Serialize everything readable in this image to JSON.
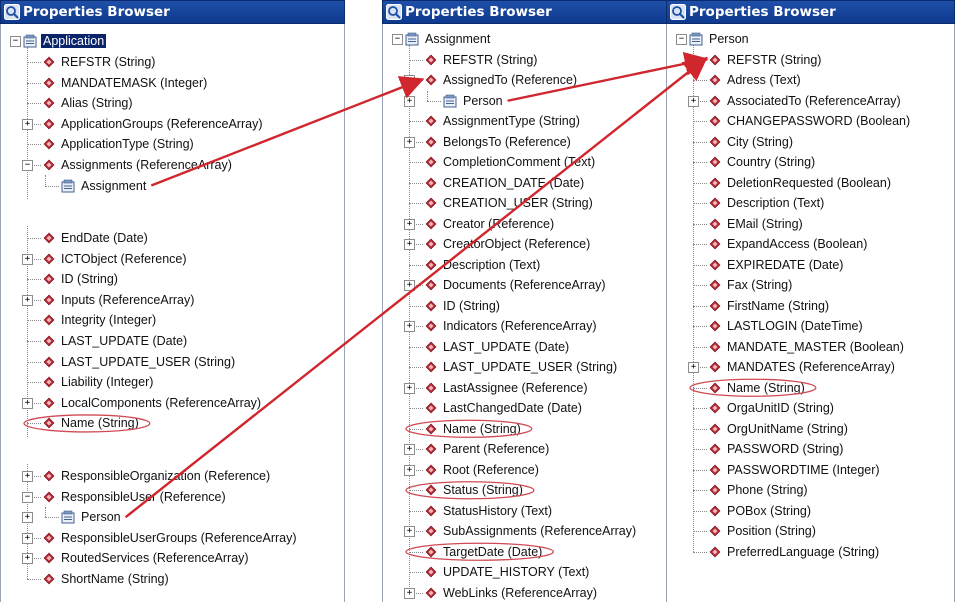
{
  "panels": [
    {
      "title": "Properties Browser",
      "rows": [
        {
          "text": "Application",
          "kind": "root",
          "exp": "-",
          "selected": true
        },
        {
          "text": "REFSTR (String)",
          "kind": "prop"
        },
        {
          "text": "MANDATEMASK (Integer)",
          "kind": "prop"
        },
        {
          "text": "Alias (String)",
          "kind": "prop"
        },
        {
          "text": "ApplicationGroups (ReferenceArray)",
          "kind": "prop",
          "exp": "+"
        },
        {
          "text": "ApplicationType (String)",
          "kind": "prop"
        },
        {
          "text": "Assignments (ReferenceArray)",
          "kind": "prop",
          "exp": "-"
        },
        {
          "text": "Assignment",
          "kind": "obj",
          "level": 2
        },
        {
          "gap": true
        },
        {
          "text": "EndDate (Date)",
          "kind": "prop"
        },
        {
          "text": "ICTObject (Reference)",
          "kind": "prop",
          "exp": "+"
        },
        {
          "text": "ID (String)",
          "kind": "prop"
        },
        {
          "text": "Inputs (ReferenceArray)",
          "kind": "prop",
          "exp": "+"
        },
        {
          "text": "Integrity (Integer)",
          "kind": "prop"
        },
        {
          "text": "LAST_UPDATE (Date)",
          "kind": "prop"
        },
        {
          "text": "LAST_UPDATE_USER (String)",
          "kind": "prop"
        },
        {
          "text": "Liability (Integer)",
          "kind": "prop"
        },
        {
          "text": "LocalComponents (ReferenceArray)",
          "kind": "prop",
          "exp": "+"
        },
        {
          "text": "Name (String)",
          "kind": "prop",
          "circled": true
        },
        {
          "gap": true
        },
        {
          "text": "ResponsibleOrganization (Reference)",
          "kind": "prop",
          "exp": "+"
        },
        {
          "text": "ResponsibleUser (Reference)",
          "kind": "prop",
          "exp": "-"
        },
        {
          "text": "Person",
          "kind": "obj",
          "level": 2,
          "exp": "+"
        },
        {
          "text": "ResponsibleUserGroups (ReferenceArray)",
          "kind": "prop",
          "exp": "+"
        },
        {
          "text": "RoutedServices (ReferenceArray)",
          "kind": "prop",
          "exp": "+"
        },
        {
          "text": "ShortName (String)",
          "kind": "prop"
        }
      ]
    },
    {
      "title": "Properties Browser",
      "rows": [
        {
          "text": "Assignment",
          "kind": "root",
          "exp": "-"
        },
        {
          "text": "REFSTR (String)",
          "kind": "prop"
        },
        {
          "text": "AssignedTo (Reference)",
          "kind": "prop",
          "exp": "-"
        },
        {
          "text": "Person",
          "kind": "obj",
          "level": 2,
          "exp": "+"
        },
        {
          "text": "AssignmentType (String)",
          "kind": "prop"
        },
        {
          "text": "BelongsTo (Reference)",
          "kind": "prop",
          "exp": "+"
        },
        {
          "text": "CompletionComment (Text)",
          "kind": "prop"
        },
        {
          "text": "CREATION_DATE (Date)",
          "kind": "prop"
        },
        {
          "text": "CREATION_USER (String)",
          "kind": "prop"
        },
        {
          "text": "Creator (Reference)",
          "kind": "prop",
          "exp": "+"
        },
        {
          "text": "CreatorObject (Reference)",
          "kind": "prop",
          "exp": "+"
        },
        {
          "text": "Description (Text)",
          "kind": "prop"
        },
        {
          "text": "Documents (ReferenceArray)",
          "kind": "prop",
          "exp": "+"
        },
        {
          "text": "ID (String)",
          "kind": "prop"
        },
        {
          "text": "Indicators (ReferenceArray)",
          "kind": "prop",
          "exp": "+"
        },
        {
          "text": "LAST_UPDATE (Date)",
          "kind": "prop"
        },
        {
          "text": "LAST_UPDATE_USER (String)",
          "kind": "prop"
        },
        {
          "text": "LastAssignee (Reference)",
          "kind": "prop",
          "exp": "+"
        },
        {
          "text": "LastChangedDate (Date)",
          "kind": "prop"
        },
        {
          "text": "Name (String)",
          "kind": "prop",
          "circled": true
        },
        {
          "text": "Parent (Reference)",
          "kind": "prop",
          "exp": "+"
        },
        {
          "text": "Root (Reference)",
          "kind": "prop",
          "exp": "+"
        },
        {
          "text": "Status (String)",
          "kind": "prop",
          "circled": true
        },
        {
          "text": "StatusHistory (Text)",
          "kind": "prop"
        },
        {
          "text": "SubAssignments (ReferenceArray)",
          "kind": "prop",
          "exp": "+"
        },
        {
          "text": "TargetDate (Date)",
          "kind": "prop",
          "circled": true
        },
        {
          "text": "UPDATE_HISTORY (Text)",
          "kind": "prop"
        },
        {
          "text": "WebLinks (ReferenceArray)",
          "kind": "prop",
          "exp": "+"
        }
      ]
    },
    {
      "title": "Properties Browser",
      "rows": [
        {
          "text": "Person",
          "kind": "root",
          "exp": "-"
        },
        {
          "text": "REFSTR (String)",
          "kind": "prop"
        },
        {
          "text": "Adress (Text)",
          "kind": "prop"
        },
        {
          "text": "AssociatedTo (ReferenceArray)",
          "kind": "prop",
          "exp": "+"
        },
        {
          "text": "CHANGEPASSWORD (Boolean)",
          "kind": "prop"
        },
        {
          "text": "City (String)",
          "kind": "prop"
        },
        {
          "text": "Country (String)",
          "kind": "prop"
        },
        {
          "text": "DeletionRequested (Boolean)",
          "kind": "prop"
        },
        {
          "text": "Description (Text)",
          "kind": "prop"
        },
        {
          "text": "EMail (String)",
          "kind": "prop"
        },
        {
          "text": "ExpandAccess (Boolean)",
          "kind": "prop"
        },
        {
          "text": "EXPIREDATE (Date)",
          "kind": "prop"
        },
        {
          "text": "Fax (String)",
          "kind": "prop"
        },
        {
          "text": "FirstName (String)",
          "kind": "prop"
        },
        {
          "text": "LASTLOGIN (DateTime)",
          "kind": "prop"
        },
        {
          "text": "MANDATE_MASTER (Boolean)",
          "kind": "prop"
        },
        {
          "text": "MANDATES (ReferenceArray)",
          "kind": "prop",
          "exp": "+"
        },
        {
          "text": "Name (String)",
          "kind": "prop",
          "circled": true
        },
        {
          "text": "OrgaUnitID (String)",
          "kind": "prop"
        },
        {
          "text": "OrgUnitName (String)",
          "kind": "prop"
        },
        {
          "text": "PASSWORD (String)",
          "kind": "prop"
        },
        {
          "text": "PASSWORDTIME (Integer)",
          "kind": "prop"
        },
        {
          "text": "Phone (String)",
          "kind": "prop"
        },
        {
          "text": "POBox (String)",
          "kind": "prop"
        },
        {
          "text": "Position (String)",
          "kind": "prop"
        },
        {
          "text": "PreferredLanguage (String)",
          "kind": "prop"
        }
      ]
    }
  ],
  "colors": {
    "title_bar": "#1a4aa0",
    "selection": "#0a246a",
    "property_icon": "#b52a35",
    "arrow": "#d0262e",
    "circle": "#d04a55"
  }
}
